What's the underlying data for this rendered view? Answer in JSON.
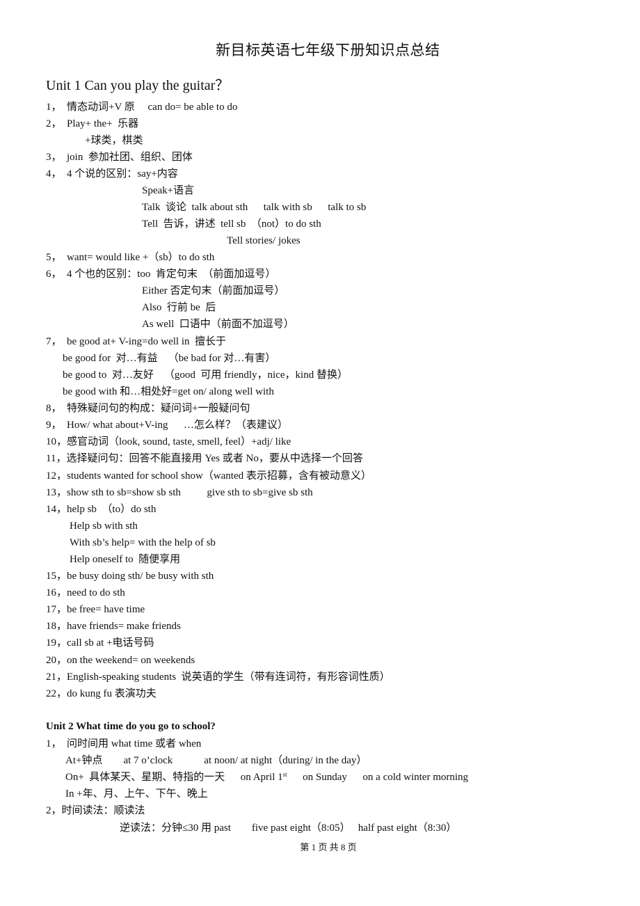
{
  "document": {
    "title": "新目标英语七年级下册知识点总结",
    "footer": "第 1 页 共 8 页"
  },
  "unit1": {
    "title": "Unit 1 Can you play the guitar？",
    "lines": [
      "1，  情态动词+V 原     can do= be able to do",
      "2，  Play+ the+  乐器",
      "+球类，棋类",
      "3，  join  参加社团、组织、团体",
      "4，  4 个说的区别：say+内容",
      "Speak+语言",
      "Talk  谈论  talk about sth      talk with sb      talk to sb",
      "Tell  告诉，讲述  tell sb  （not）to do sth",
      "Tell stories/ jokes",
      "5，  want= would like +（sb）to do sth",
      "6，  4 个也的区别：too  肯定句末  （前面加逗号）",
      "Either 否定句末（前面加逗号）",
      "Also  行前 be  后",
      "As well  口语中（前面不加逗号）",
      "7，  be good at+ V-ing=do well in  擅长于",
      "be good for  对…有益    （be bad for 对…有害）",
      "be good to  对…友好    （good  可用 friendly，nice，kind 替换）",
      "be good with 和…相处好=get on/ along well with",
      "8，  特殊疑问句的构成：疑问词+一般疑问句",
      "9，  How/ what about+V-ing      …怎么样？（表建议）",
      "10，感官动词（look, sound, taste, smell, feel）+adj/ like",
      "11，选择疑问句：回答不能直接用 Yes 或者 No，要从中选择一个回答",
      "12，students wanted for school show（wanted 表示招募，含有被动意义）",
      "13，show sth to sb=show sb sth          give sth to sb=give sb sth",
      "14，help sb  （to）do sth",
      "Help sb with sth",
      "With sb’s help= with the help of sb",
      "Help oneself to  随便享用",
      "15，be busy doing sth/ be busy with sth",
      "16，need to do sth",
      "17，be free= have time",
      "18，have friends= make friends",
      "19，call sb at +电话号码",
      "20，on the weekend= on weekends",
      "21，English-speaking students  说英语的学生（带有连词符，有形容词性质）",
      "22，do kung fu 表演功夫"
    ]
  },
  "unit2": {
    "title": "Unit 2 What time do you go to school?",
    "lines": [
      "1，  问时间用 what time 或者 when",
      "At+钟点        at 7 o’clock            at noon/ at night（during/ in the day）",
      "On+  具体某天、星期、特指的一天      on April 1",
      "st",
      "      on Sunday      on a cold winter morning",
      "In +年、月、上午、下午、晚上",
      "2，时间读法：顺读法",
      "逆读法：分钟≤30 用 past        five past eight（8:05）   half past eight（8:30）"
    ]
  }
}
